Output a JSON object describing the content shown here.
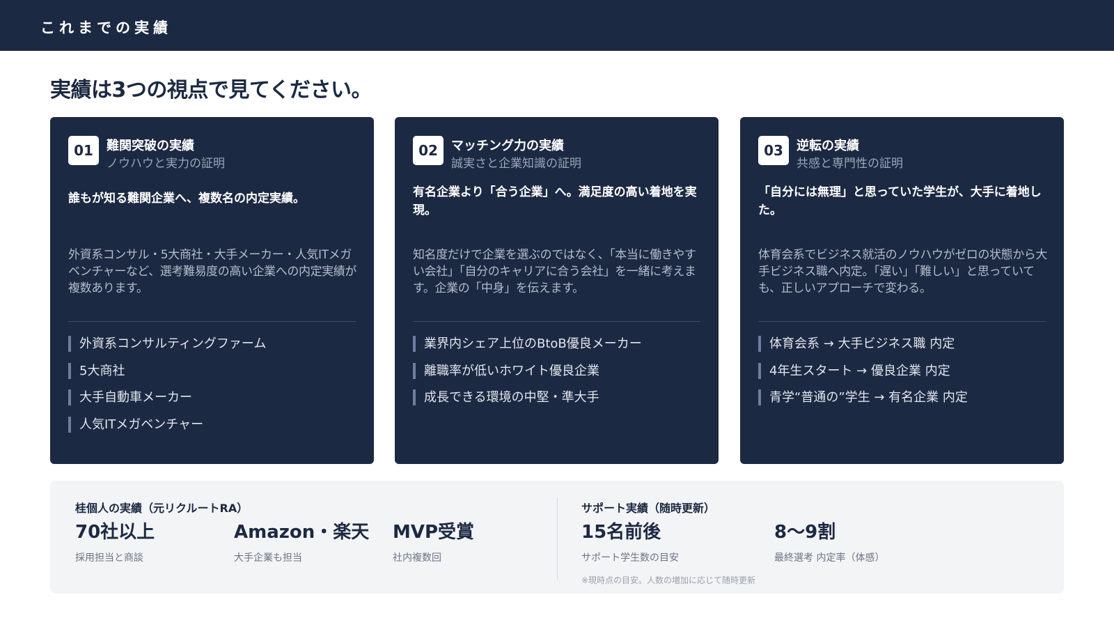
{
  "header": {
    "title": "これまでの実績"
  },
  "headline": "実績は3つの視点で見てください。",
  "cards": [
    {
      "num": "01",
      "title": "難関突破の実績",
      "subtitle": "ノウハウと実力の証明",
      "lead": "誰もが知る難関企業へ、複数名の内定実績。",
      "body": "外資系コンサル・5大商社・大手メーカー・人気ITメガベンチャーなど、選考難易度の高い企業への内定実績が複数あります。",
      "items": [
        "外資系コンサルティングファーム",
        "5大商社",
        "大手自動車メーカー",
        "人気ITメガベンチャー"
      ]
    },
    {
      "num": "02",
      "title": "マッチング力の実績",
      "subtitle": "誠実さと企業知識の証明",
      "lead": "有名企業より「合う企業」へ。満足度の高い着地を実現。",
      "body": "知名度だけで企業を選ぶのではなく、「本当に働きやすい会社」「自分のキャリアに合う会社」を一緒に考えます。企業の「中身」を伝えます。",
      "items": [
        "業界内シェア上位のBtoB優良メーカー",
        "離職率が低いホワイト優良企業",
        "成長できる環境の中堅・準大手"
      ]
    },
    {
      "num": "03",
      "title": "逆転の実績",
      "subtitle": "共感と専門性の証明",
      "lead": "「自分には無理」と思っていた学生が、大手に着地した。",
      "body": "体育会系でビジネス就活のノウハウがゼロの状態から大手ビジネス職へ内定。「遅い」「難しい」と思っていても、正しいアプローチで変わる。",
      "items": [
        "体育会系 → 大手ビジネス職 内定",
        "4年生スタート → 優良企業 内定",
        "青学“普通の”学生 → 有名企業 内定"
      ]
    }
  ],
  "stats": {
    "left_heading": "桂個人の実績（元リクルートRA）",
    "left": [
      {
        "value": "70社以上",
        "label": "採用担当と商談"
      },
      {
        "value": "Amazon・楽天",
        "label": "大手企業も担当"
      },
      {
        "value": "MVP受賞",
        "label": "社内複数回"
      }
    ],
    "right_heading": "サポート実績（随時更新）",
    "right": [
      {
        "value": "15名前後",
        "label": "サポート学生数の目安"
      },
      {
        "value": "8〜9割",
        "label": "最終選考 内定率（体感）"
      }
    ],
    "note": "※現時点の目安。人数の増加に応じて随時更新"
  }
}
